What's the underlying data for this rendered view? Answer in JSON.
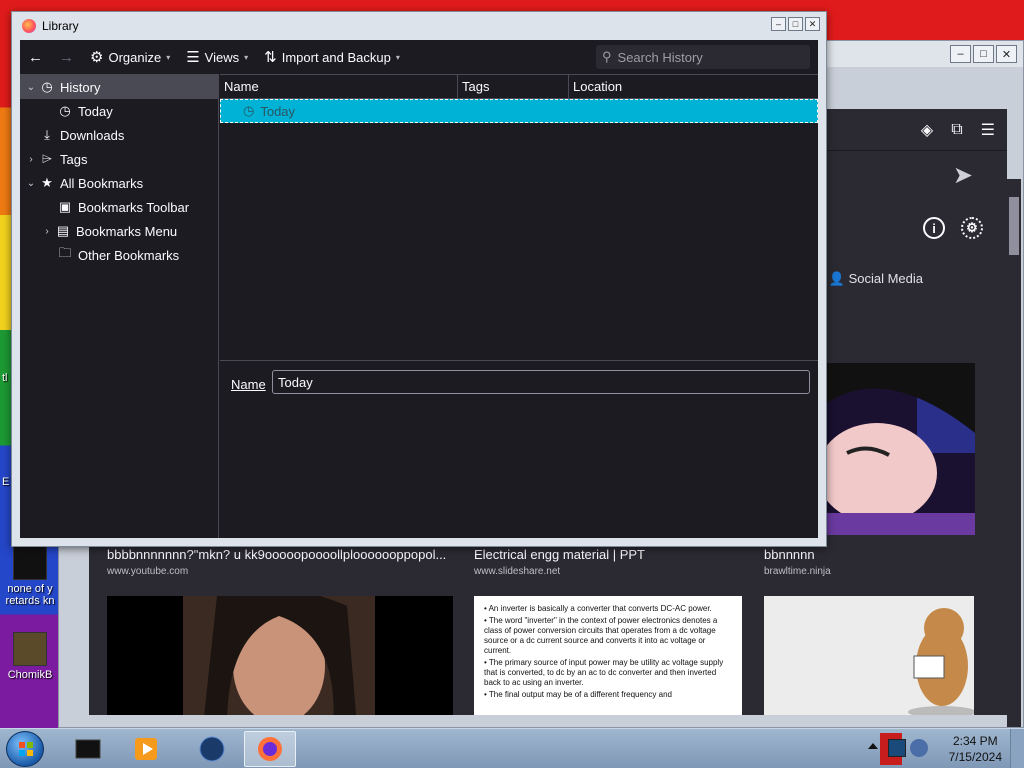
{
  "desktop": {
    "icons": [
      {
        "label": "none of y retards kn",
        "icon": "app-icon"
      },
      {
        "label": "ChomikB",
        "icon": "hamster-icon"
      }
    ],
    "edge_labels": [
      "tl",
      "E"
    ]
  },
  "background_browser": {
    "right_toolbar_icons": [
      "pocket-icon",
      "extensions-icon",
      "menu-icon"
    ],
    "social_label": "Social Media",
    "tiles": [
      {
        "title": "bbbbnnnnnnn?\"mkn? u kk9ooooopoooollplooooooppopol...",
        "url": "www.youtube.com"
      },
      {
        "title": "Electrical engg material | PPT",
        "url": "www.slideshare.net"
      },
      {
        "title": "bbnnnnn",
        "url": "brawltime.ninja"
      }
    ],
    "doc_preview_lines": [
      "• An inverter is basically a converter that converts DC-AC power.",
      "• The word \"inverter\" in the context of power electronics denotes a class of power conversion circuits that operates from a dc voltage source or a dc current source and converts it into ac voltage or current.",
      "• The primary source of input power may be utility ac voltage supply that is converted, to dc by an ac to dc converter and then inverted back to ac using an inverter.",
      "• The final output may be of a different frequency and"
    ]
  },
  "library": {
    "title": "Library",
    "toolbar": {
      "organize": "Organize",
      "views": "Views",
      "import_backup": "Import and Backup",
      "search_placeholder": "Search History"
    },
    "tree": [
      {
        "label": "History",
        "icon": "clock-icon",
        "level": 0,
        "expanded": true,
        "selected": true
      },
      {
        "label": "Today",
        "icon": "clock-icon",
        "level": 1
      },
      {
        "label": "Downloads",
        "icon": "download-icon",
        "level": 0
      },
      {
        "label": "Tags",
        "icon": "tag-icon",
        "level": 0,
        "collapsed": true
      },
      {
        "label": "All Bookmarks",
        "icon": "star-icon",
        "level": 0,
        "expanded": true
      },
      {
        "label": "Bookmarks Toolbar",
        "icon": "bookmark-toolbar-icon",
        "level": 1
      },
      {
        "label": "Bookmarks Menu",
        "icon": "bookmark-menu-icon",
        "level": 1,
        "collapsed": true
      },
      {
        "label": "Other Bookmarks",
        "icon": "folder-icon",
        "level": 1
      }
    ],
    "columns": [
      "Name",
      "Tags",
      "Location"
    ],
    "rows": [
      {
        "name": "Today",
        "tags": "",
        "location": ""
      }
    ],
    "details": {
      "name_label": "Name",
      "name_value": "Today"
    }
  },
  "taskbar": {
    "apps": [
      "terminal-icon",
      "media-player-icon",
      "globe-icon",
      "firefox-icon"
    ],
    "clock_time": "2:34 PM",
    "clock_date": "7/15/2024"
  },
  "colors": {
    "library_bg": "#1c1b22",
    "selection": "#00b3d6",
    "taskbar": "#9fb6cf"
  }
}
